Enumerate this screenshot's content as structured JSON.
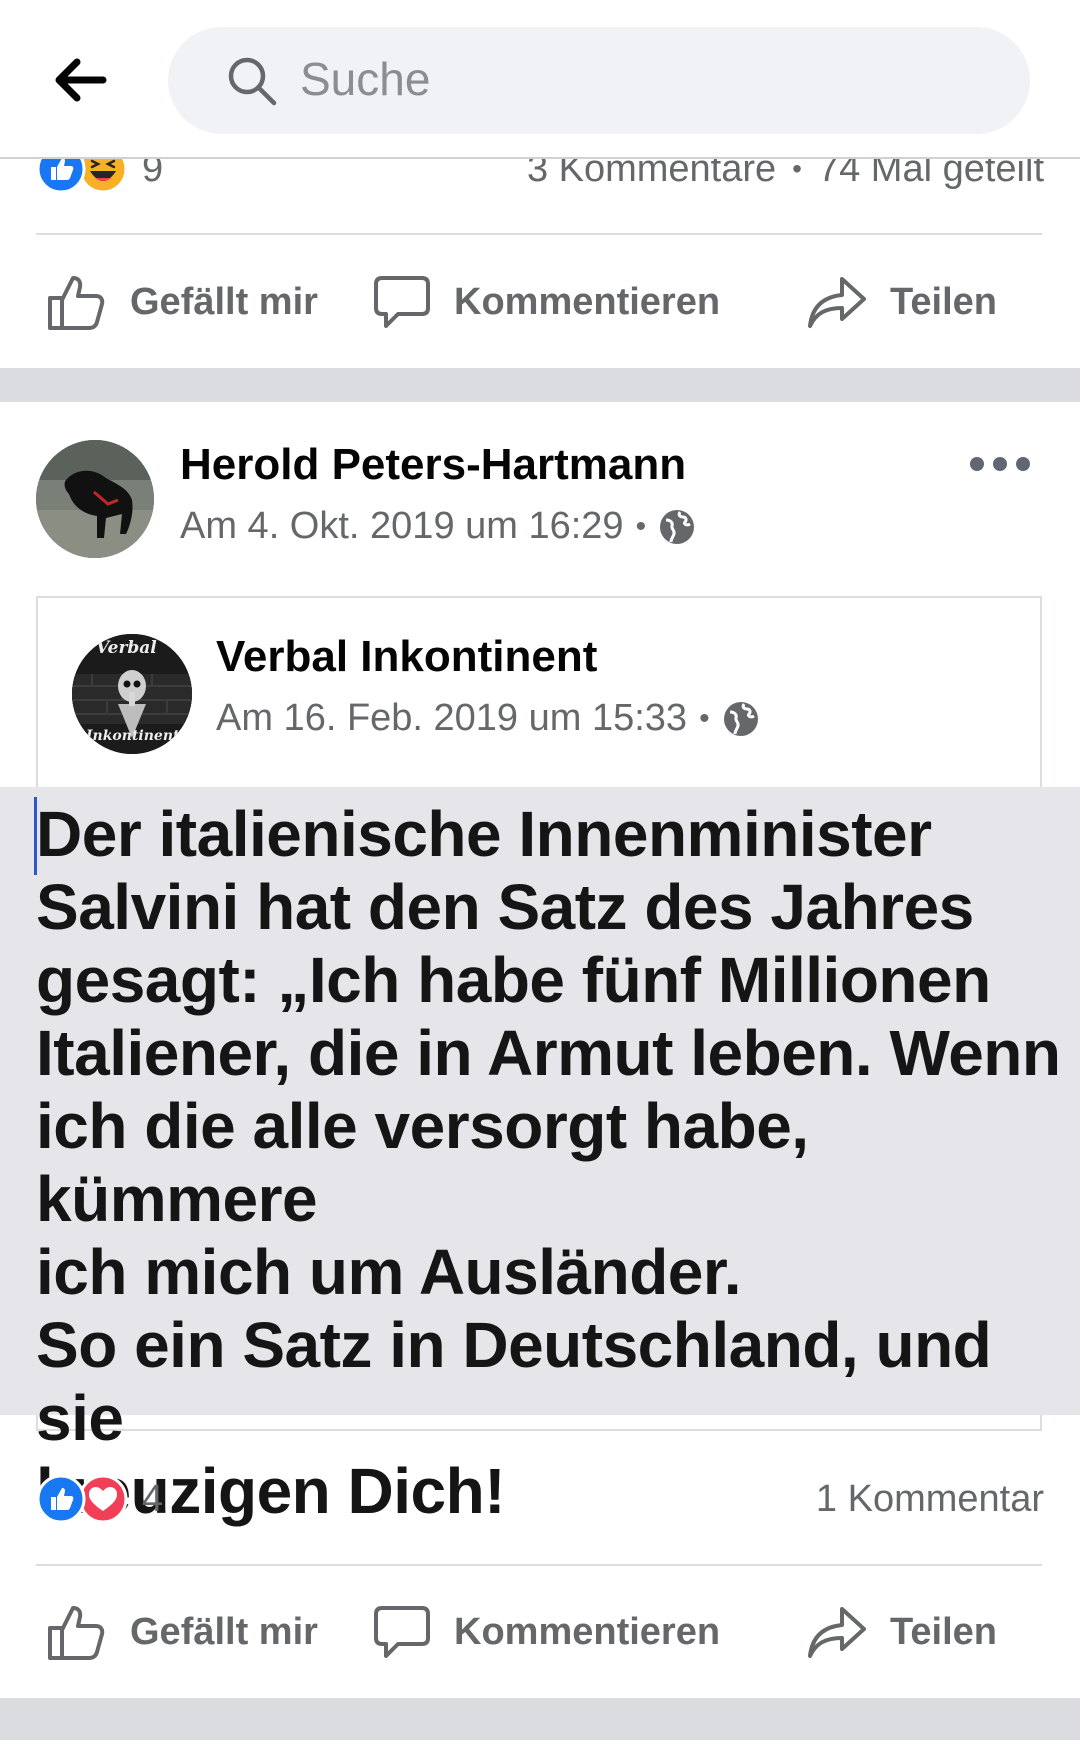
{
  "header": {
    "search_placeholder": "Suche"
  },
  "top_post": {
    "reaction_count": "9",
    "comments": "3 Kommentare",
    "shares": "74 Mal geteilt",
    "separator": "•",
    "reactions": [
      "like-icon",
      "haha-icon"
    ]
  },
  "actions": {
    "like": "Gefällt mir",
    "comment": "Kommentieren",
    "share": "Teilen"
  },
  "post": {
    "author": "Herold Peters-Hartmann",
    "date": "Am 4. Okt. 2019 um 16:29",
    "separator": "•",
    "privacy_icon": "globe-icon",
    "shared": {
      "author": "Verbal Inkontinent",
      "date": "Am 16. Feb. 2019 um 15:33",
      "separator": "•",
      "avatar_text_top": "Verbal",
      "avatar_text_bottom": "Inkontinent",
      "quote_lines": [
        "Der italienische Innenminister",
        "Salvini hat den Satz des Jahres",
        "gesagt: „Ich habe fünf Millionen",
        "Italiener, die in Armut leben. Wenn",
        "ich die alle versorgt habe, kümmere",
        "ich mich um Ausländer.",
        "So ein Satz in Deutschland, und sie",
        "kreuzigen Dich!"
      ]
    },
    "reaction_count": "4",
    "comments": "1 Kommentar",
    "reactions": [
      "like-icon",
      "love-icon"
    ]
  },
  "colors": {
    "like_blue": "#1877f2",
    "love_red": "#f33e58",
    "haha_yellow": "#f7b125",
    "muted": "#65676b",
    "band": "#dadce0"
  }
}
